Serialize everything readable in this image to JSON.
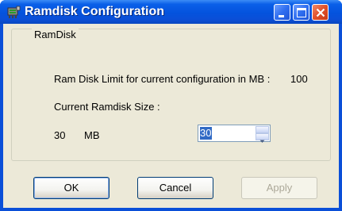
{
  "window": {
    "title": "Ramdisk Configuration",
    "icon": "ramdisk-app-icon"
  },
  "titlebar_buttons": {
    "minimize_icon": "minimize-icon",
    "maximize_icon": "maximize-icon",
    "close_icon": "close-icon"
  },
  "group": {
    "legend": "RamDisk",
    "limit_text": "Ram Disk Limit for current configuration in MB :",
    "limit_value": "100",
    "current_label": "Current Ramdisk Size :",
    "size_value": "30",
    "size_unit": "MB"
  },
  "spinner": {
    "value": "30",
    "up_icon": "spin-up-icon",
    "down_icon": "spin-down-icon"
  },
  "buttons": {
    "ok": "OK",
    "cancel": "Cancel",
    "apply": "Apply"
  },
  "colors": {
    "titlebar": "#0a4fd8",
    "dialog_bg": "#ece9d8",
    "selection": "#316ac5",
    "disabled_text": "#aca899"
  }
}
